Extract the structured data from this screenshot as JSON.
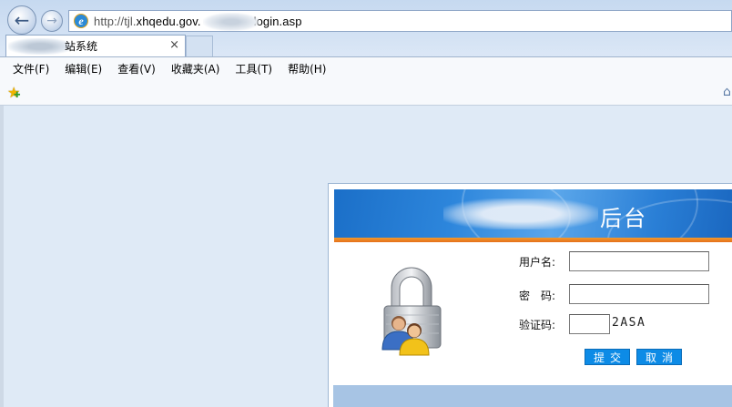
{
  "browser": {
    "url": "http://tjl.xhqedu.gov.          login.asp",
    "url_before": "http://tjl.",
    "url_domain": "xhqedu.gov.",
    "url_after": "login.asp",
    "tab_title": "站系统",
    "tab_close": "×",
    "menu": [
      "文件(F)",
      "编辑(E)",
      "查看(V)",
      "收藏夹(A)",
      "工具(T)",
      "帮助(H)"
    ]
  },
  "login": {
    "header_title": "后台",
    "username_label": "用户名:",
    "password_label": "密　码:",
    "captcha_label": "验证码:",
    "captcha_code": "2ASA",
    "submit_label": "提交",
    "cancel_label": "取消"
  },
  "colors": {
    "header_blue": "#2d86dc",
    "stripe_orange": "#e4701a",
    "button_blue": "#0d8be6",
    "page_background": "#dfeaf6"
  },
  "icons": [
    "back-arrow-icon",
    "forward-arrow-icon",
    "ie-icon",
    "favorites-star-icon",
    "home-icon",
    "lock-users-icon"
  ]
}
